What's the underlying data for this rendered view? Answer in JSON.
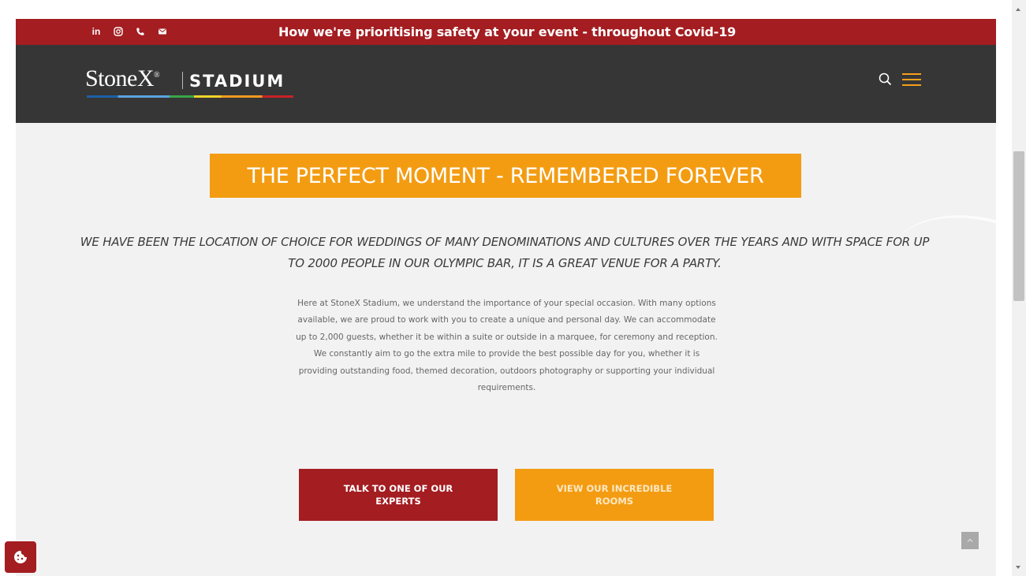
{
  "topbar": {
    "social_icons": [
      "linkedin-icon",
      "instagram-icon",
      "phone-icon",
      "email-icon"
    ],
    "linkedin_label": "in",
    "safety_link": "How we're prioritising safety at your event - throughout Covid-19"
  },
  "header": {
    "logo_main": "StoneX",
    "logo_sup": "®",
    "logo_secondary": "STADIUM",
    "search_icon": "search-icon",
    "menu_icon": "hamburger-menu-icon"
  },
  "hero": {
    "title": "THE PERFECT MOMENT - REMEMBERED FOREVER",
    "intro": "WE HAVE BEEN THE LOCATION OF CHOICE FOR WEDDINGS OF MANY DENOMINATIONS AND CULTURES OVER THE YEARS AND WITH SPACE FOR UP TO 2000 PEOPLE IN OUR OLYMPIC BAR, IT IS A GREAT VENUE FOR A PARTY.",
    "body": "Here at StoneX Stadium, we understand the importance of your special occasion. With many options available, we are proud to work with you to create a unique and personal day. We can accommodate up to 2,000 guests, whether it be within a suite or outside in a marquee, for ceremony and reception. We constantly aim to go the extra mile to provide the best possible day for you, whether it is providing outstanding food, themed decoration, outdoors photography or supporting your individual requirements.",
    "buttons": {
      "talk": "TALK TO ONE OF OUR EXPERTS",
      "rooms": "VIEW OUR INCREDIBLE ROOMS"
    }
  },
  "colors": {
    "brand_red": "#a31d21",
    "brand_orange": "#f39c12",
    "header_dark": "#363636"
  },
  "widgets": {
    "cookie_icon": "cookie-icon",
    "back_to_top_icon": "chevron-up-icon"
  }
}
